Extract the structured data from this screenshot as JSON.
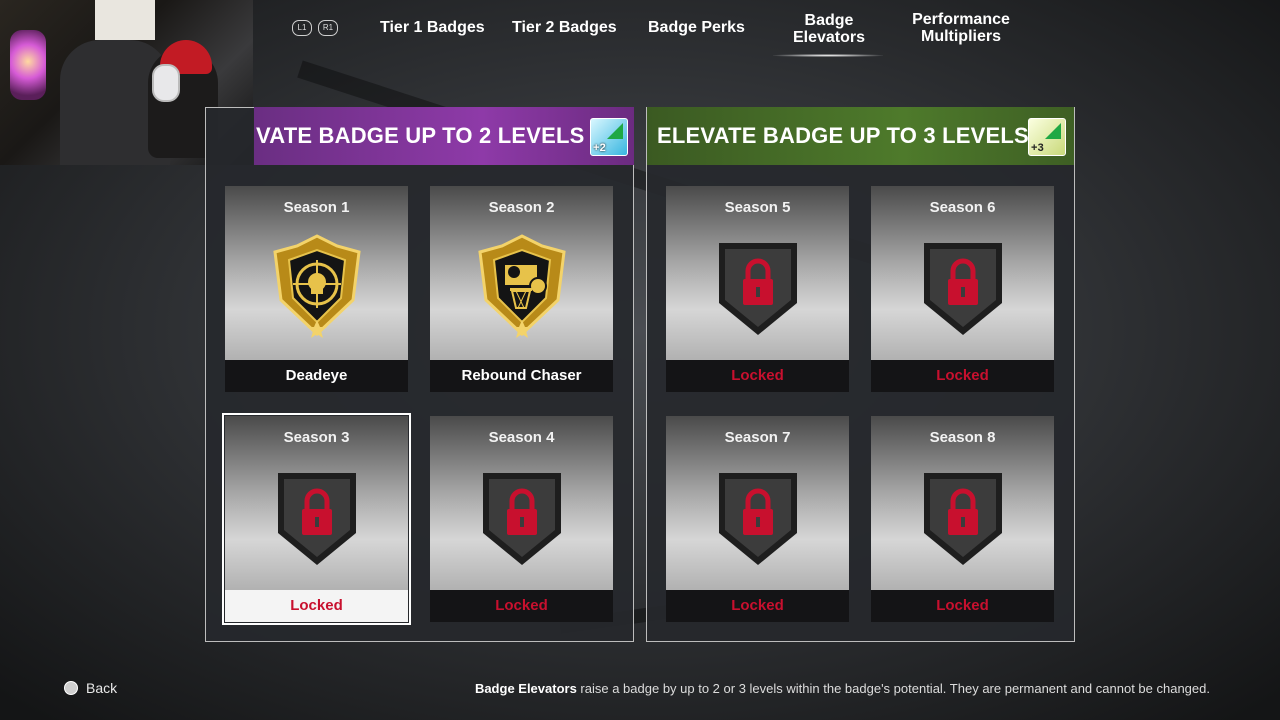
{
  "nav": {
    "bumper_left": "L1",
    "bumper_right": "R1",
    "tabs": [
      {
        "label": "Tier 1 Badges"
      },
      {
        "label": "Tier 2 Badges"
      },
      {
        "label": "Badge Perks"
      },
      {
        "label": "Badge Elevators",
        "line1": "Badge",
        "line2": "Elevators",
        "active": true
      },
      {
        "label": "Performance Multipliers",
        "line1": "Performance",
        "line2": "Multipliers"
      }
    ]
  },
  "panels": [
    {
      "title": "VATE BADGE UP TO 2 LEVELS",
      "level_icon": {
        "name": "elevate-plus-2-icon",
        "text": "+2"
      },
      "cards": [
        {
          "season": "Season 1",
          "footer": "Deadeye",
          "locked": false,
          "icon": "deadeye-badge-icon"
        },
        {
          "season": "Season 2",
          "footer": "Rebound Chaser",
          "locked": false,
          "icon": "rebound-chaser-badge-icon"
        },
        {
          "season": "Season 3",
          "footer": "Locked",
          "locked": true,
          "selected": true,
          "icon": "lock-icon"
        },
        {
          "season": "Season 4",
          "footer": "Locked",
          "locked": true,
          "icon": "lock-icon"
        }
      ]
    },
    {
      "title": "ELEVATE BADGE UP TO 3 LEVELS",
      "level_icon": {
        "name": "elevate-plus-3-icon",
        "text": "+3"
      },
      "cards": [
        {
          "season": "Season 5",
          "footer": "Locked",
          "locked": true,
          "icon": "lock-icon"
        },
        {
          "season": "Season 6",
          "footer": "Locked",
          "locked": true,
          "icon": "lock-icon"
        },
        {
          "season": "Season 7",
          "footer": "Locked",
          "locked": true,
          "icon": "lock-icon"
        },
        {
          "season": "Season 8",
          "footer": "Locked",
          "locked": true,
          "icon": "lock-icon"
        }
      ]
    }
  ],
  "footer": {
    "back_label": "Back",
    "hint_bold": "Badge Elevators",
    "hint_text": " raise a badge by up to 2 or 3 levels within the badge's potential. They are permanent and cannot be changed."
  },
  "colors": {
    "locked_red": "#c8102e",
    "gold": "#d4a824",
    "header_purple": "#8e3aa8",
    "header_green": "#4e7a2b"
  }
}
